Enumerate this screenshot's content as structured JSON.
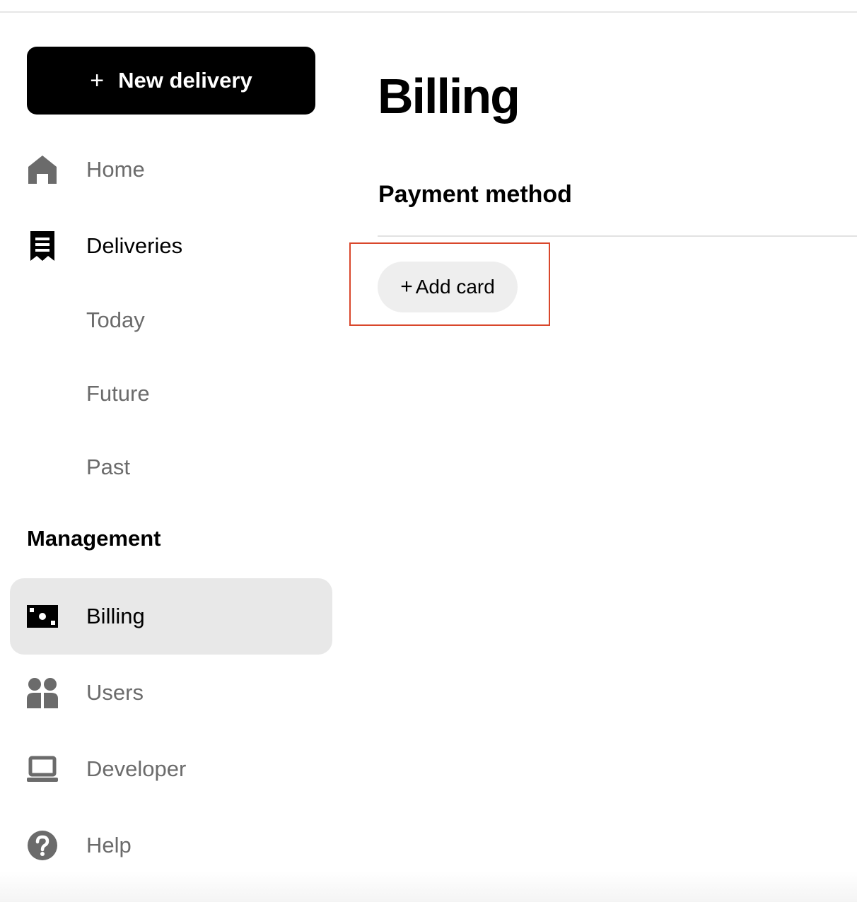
{
  "sidebar": {
    "new_delivery": {
      "icon": "plus-icon",
      "plus": "+",
      "label": "New delivery"
    },
    "items": [
      {
        "label": "Home",
        "icon": "home-icon"
      },
      {
        "label": "Deliveries",
        "icon": "receipt-icon"
      }
    ],
    "sub_items": [
      {
        "label": "Today"
      },
      {
        "label": "Future"
      },
      {
        "label": "Past"
      }
    ],
    "management_heading": "Management",
    "management_items": [
      {
        "label": "Billing",
        "icon": "cash-icon",
        "selected": true
      },
      {
        "label": "Users",
        "icon": "users-icon"
      },
      {
        "label": "Developer",
        "icon": "laptop-icon"
      },
      {
        "label": "Help",
        "icon": "help-icon"
      }
    ]
  },
  "main": {
    "title": "Billing",
    "section_title": "Payment method",
    "add_card": {
      "plus": "+",
      "label": "Add card",
      "icon": "plus-icon"
    }
  },
  "colors": {
    "primary": "#000000",
    "muted_text": "#6b6b6b",
    "selected_bg": "#e8e8e8",
    "focus_outline": "#d9472b"
  }
}
